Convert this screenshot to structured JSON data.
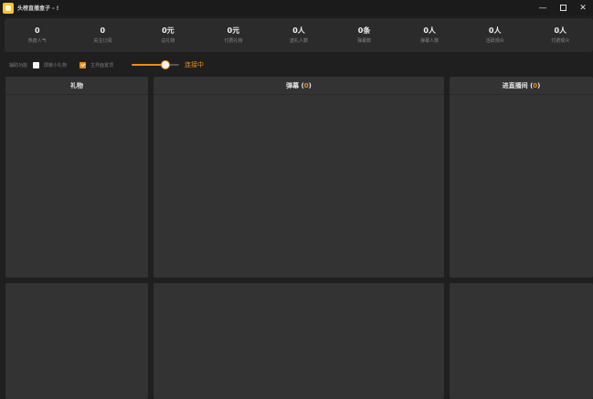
{
  "window": {
    "title": "头榜直播盒子 - !"
  },
  "stats": [
    {
      "value": "0",
      "label": "热度人气"
    },
    {
      "value": "0",
      "label": "关注订阅"
    },
    {
      "value": "0元",
      "label": "总礼物"
    },
    {
      "value": "0元",
      "label": "付费礼物"
    },
    {
      "value": "0人",
      "label": "送礼人数"
    },
    {
      "value": "0条",
      "label": "弹幕数"
    },
    {
      "value": "0人",
      "label": "弹幕人数"
    },
    {
      "value": "0人",
      "label": "活跃观众"
    },
    {
      "value": "0人",
      "label": "付费观众"
    }
  ],
  "options": {
    "label": "辅助功能",
    "filter_small_gift": {
      "label": "屏蔽小礼物",
      "checked": false
    },
    "anchor_top": {
      "label": "主界面置顶",
      "checked": true
    },
    "slider_value": 0.75,
    "status": "连接中"
  },
  "panels": {
    "gifts": {
      "title": "礼物"
    },
    "danmaku": {
      "title": "弹幕",
      "count": "0"
    },
    "enter_room": {
      "title": "进直播间",
      "count": "0"
    }
  },
  "colors": {
    "accent": "#f08c14",
    "panel": "#333333",
    "background": "#1f1f1f"
  }
}
